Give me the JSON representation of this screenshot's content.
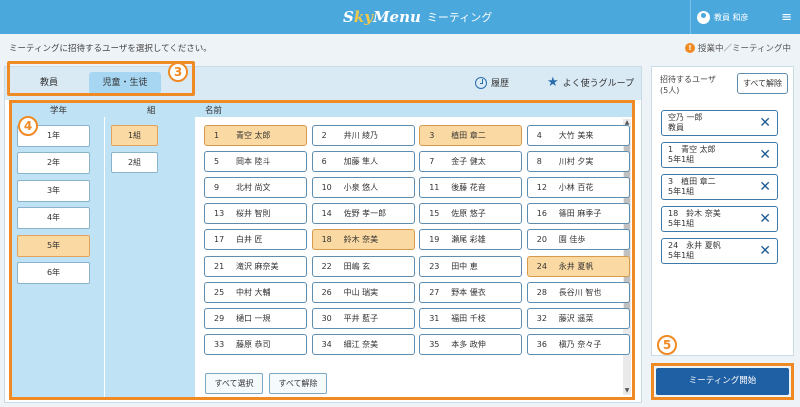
{
  "app": {
    "logo_s": "S",
    "logo_y": "ky",
    "logo_menu": "Menu",
    "title": "ミーティング"
  },
  "user": {
    "name": "教員 和彦"
  },
  "instruction": "ミーティングに招待するユーザを選択してください。",
  "status": {
    "icon": "!",
    "text": "授業中／ミーティング中"
  },
  "tabs": [
    {
      "label": "教員",
      "active": false
    },
    {
      "label": "児童・生徒",
      "active": true
    }
  ],
  "toolbar": {
    "history_label": "履歴",
    "favorite_groups_label": "よく使うグループ"
  },
  "columns": {
    "grade": "学年",
    "class": "組",
    "name": "名前"
  },
  "grades": [
    {
      "label": "1年",
      "selected": false
    },
    {
      "label": "2年",
      "selected": false
    },
    {
      "label": "3年",
      "selected": false
    },
    {
      "label": "4年",
      "selected": false
    },
    {
      "label": "5年",
      "selected": true
    },
    {
      "label": "6年",
      "selected": false
    }
  ],
  "classes": [
    {
      "label": "1組",
      "selected": true
    },
    {
      "label": "2組",
      "selected": false
    }
  ],
  "students": [
    {
      "num": "1",
      "name": "青空 太郎",
      "selected": true
    },
    {
      "num": "2",
      "name": "井川 綾乃",
      "selected": false
    },
    {
      "num": "3",
      "name": "植田 章二",
      "selected": true
    },
    {
      "num": "4",
      "name": "大竹 美来",
      "selected": false
    },
    {
      "num": "5",
      "name": "岡本 陸斗",
      "selected": false
    },
    {
      "num": "6",
      "name": "加藤 隼人",
      "selected": false
    },
    {
      "num": "7",
      "name": "金子 健太",
      "selected": false
    },
    {
      "num": "8",
      "name": "川村 夕実",
      "selected": false
    },
    {
      "num": "9",
      "name": "北村 尚文",
      "selected": false
    },
    {
      "num": "10",
      "name": "小泉 悠人",
      "selected": false
    },
    {
      "num": "11",
      "name": "後藤 花音",
      "selected": false
    },
    {
      "num": "12",
      "name": "小林 百花",
      "selected": false
    },
    {
      "num": "13",
      "name": "桜井 智則",
      "selected": false
    },
    {
      "num": "14",
      "name": "佐野 孝一郎",
      "selected": false
    },
    {
      "num": "15",
      "name": "佐原 悠子",
      "selected": false
    },
    {
      "num": "16",
      "name": "篠田 麻季子",
      "selected": false
    },
    {
      "num": "17",
      "name": "白井 匠",
      "selected": false
    },
    {
      "num": "18",
      "name": "鈴木 奈美",
      "selected": true
    },
    {
      "num": "19",
      "name": "瀬尾 彩雄",
      "selected": false
    },
    {
      "num": "20",
      "name": "園 佳歩",
      "selected": false
    },
    {
      "num": "21",
      "name": "滝沢 麻奈美",
      "selected": false
    },
    {
      "num": "22",
      "name": "田嶋 玄",
      "selected": false
    },
    {
      "num": "23",
      "name": "田中 恵",
      "selected": false
    },
    {
      "num": "24",
      "name": "永井 夏帆",
      "selected": true
    },
    {
      "num": "25",
      "name": "中村 大輔",
      "selected": false
    },
    {
      "num": "26",
      "name": "中山 瑞実",
      "selected": false
    },
    {
      "num": "27",
      "name": "野本 優衣",
      "selected": false
    },
    {
      "num": "28",
      "name": "長谷川 智也",
      "selected": false
    },
    {
      "num": "29",
      "name": "樋口 一規",
      "selected": false
    },
    {
      "num": "30",
      "name": "平井 藍子",
      "selected": false
    },
    {
      "num": "31",
      "name": "福田 千枝",
      "selected": false
    },
    {
      "num": "32",
      "name": "藤沢 遥菜",
      "selected": false
    },
    {
      "num": "33",
      "name": "藤原 恭司",
      "selected": false
    },
    {
      "num": "34",
      "name": "細江 奈美",
      "selected": false
    },
    {
      "num": "35",
      "name": "本多 政伸",
      "selected": false
    },
    {
      "num": "36",
      "name": "槇乃 奈々子",
      "selected": false
    }
  ],
  "actions": {
    "select_all": "すべて選択",
    "clear_all": "すべて解除"
  },
  "invite": {
    "title_line1": "招待するユーザ",
    "title_line2": "(5人)",
    "clear_all": "すべて解除",
    "items": [
      {
        "line1": "空乃 一郎",
        "line2": "教員"
      },
      {
        "line1": "1　青空 太郎",
        "line2": "5年1組"
      },
      {
        "line1": "3　植田 章二",
        "line2": "5年1組"
      },
      {
        "line1": "18　鈴木 奈美",
        "line2": "5年1組"
      },
      {
        "line1": "24　永井 夏帆",
        "line2": "5年1組"
      }
    ]
  },
  "start_button": "ミーティング開始",
  "callouts": {
    "tabs": "3",
    "selection_area": "4",
    "start": "5"
  },
  "icons": {
    "user": "user-icon",
    "menu": "menu-icon",
    "status": "info-icon",
    "history": "clock-icon",
    "groups": "star-icon",
    "remove": "close-icon",
    "menu_glyph": "≡",
    "star_glyph": "★",
    "remove_glyph": "✕"
  },
  "colors": {
    "header": "#4aa8dc",
    "selected": "#fbd9a2",
    "callout": "#f08a24",
    "primary_button": "#1f5fa3",
    "column_bg": "#bfe2f5"
  }
}
